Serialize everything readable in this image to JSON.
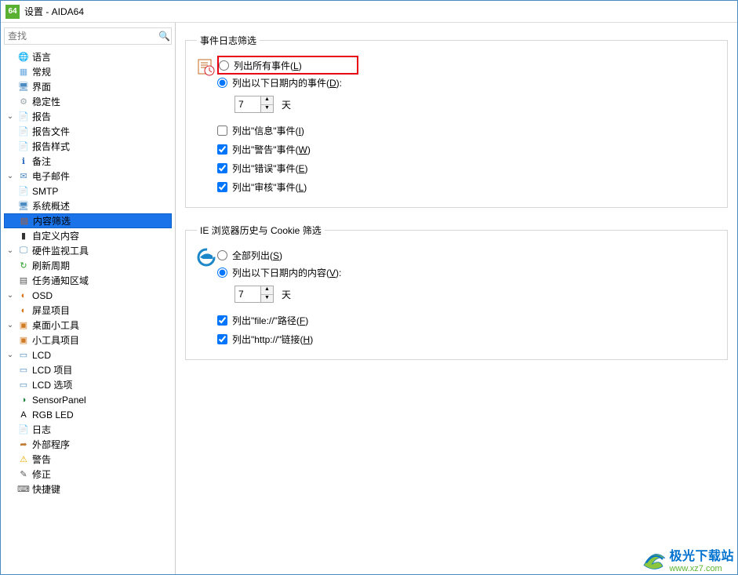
{
  "window": {
    "appicon": "64",
    "title": "设置 - AIDA64"
  },
  "search": {
    "placeholder": "查找"
  },
  "tree": [
    {
      "label": "语言",
      "depth": 0,
      "caret": "",
      "iconColor": "#1aa21a",
      "iconChar": "🌐"
    },
    {
      "label": "常规",
      "depth": 0,
      "caret": "",
      "iconColor": "#6aa9df",
      "iconChar": "▦"
    },
    {
      "label": "界面",
      "depth": 0,
      "caret": "",
      "iconColor": "#4d8cc2",
      "iconChar": "🖥"
    },
    {
      "label": "稳定性",
      "depth": 0,
      "caret": "",
      "iconColor": "#9aa6ad",
      "iconChar": "⚙"
    },
    {
      "label": "报告",
      "depth": 0,
      "caret": "v",
      "iconColor": "#e4aa35",
      "iconChar": "📄"
    },
    {
      "label": "报告文件",
      "depth": 1,
      "caret": "",
      "iconColor": "#999",
      "iconChar": "📄"
    },
    {
      "label": "报告样式",
      "depth": 1,
      "caret": "",
      "iconColor": "#999",
      "iconChar": "📄"
    },
    {
      "label": "备注",
      "depth": 1,
      "caret": "",
      "iconColor": "#2d6bc1",
      "iconChar": "ℹ"
    },
    {
      "label": "电子邮件",
      "depth": 0,
      "caret": "v",
      "iconColor": "#4d8cc2",
      "iconChar": "✉"
    },
    {
      "label": "SMTP",
      "depth": 1,
      "caret": "",
      "iconColor": "#999",
      "iconChar": "📄"
    },
    {
      "label": "系统概述",
      "depth": 0,
      "caret": "",
      "iconColor": "#4d8cc2",
      "iconChar": "🖥"
    },
    {
      "label": "内容筛选",
      "depth": 0,
      "caret": "",
      "iconColor": "#b06030",
      "iconChar": "▤",
      "selected": true
    },
    {
      "label": "自定义内容",
      "depth": 0,
      "caret": "",
      "iconColor": "#333",
      "iconChar": "▮"
    },
    {
      "label": "硬件监视工具",
      "depth": 0,
      "caret": "v",
      "iconColor": "#4d8cc2",
      "iconChar": "🖵"
    },
    {
      "label": "刷新周期",
      "depth": 1,
      "caret": "",
      "iconColor": "#2a9e2a",
      "iconChar": "↻"
    },
    {
      "label": "任务通知区域",
      "depth": 1,
      "caret": "",
      "iconColor": "#555",
      "iconChar": "▤"
    },
    {
      "label": "OSD",
      "depth": 1,
      "caret": "v",
      "iconColor": "#d86f12",
      "iconChar": "◐"
    },
    {
      "label": "屏显项目",
      "depth": 2,
      "caret": "",
      "iconColor": "#d86f12",
      "iconChar": "◐"
    },
    {
      "label": "桌面小工具",
      "depth": 1,
      "caret": "v",
      "iconColor": "#d07b25",
      "iconChar": "▣"
    },
    {
      "label": "小工具项目",
      "depth": 2,
      "caret": "",
      "iconColor": "#d07b25",
      "iconChar": "▣"
    },
    {
      "label": "LCD",
      "depth": 1,
      "caret": "v",
      "iconColor": "#4d8cc2",
      "iconChar": "▭"
    },
    {
      "label": "LCD 项目",
      "depth": 2,
      "caret": "",
      "iconColor": "#4d8cc2",
      "iconChar": "▭"
    },
    {
      "label": "LCD 选项",
      "depth": 2,
      "caret": "",
      "iconColor": "#4d8cc2",
      "iconChar": "▭"
    },
    {
      "label": "SensorPanel",
      "depth": 1,
      "caret": "",
      "iconColor": "#20833d",
      "iconChar": "◑"
    },
    {
      "label": "RGB LED",
      "depth": 1,
      "caret": "",
      "iconColor": "#000",
      "iconChar": "A"
    },
    {
      "label": "日志",
      "depth": 1,
      "caret": "",
      "iconColor": "#999",
      "iconChar": "📄"
    },
    {
      "label": "外部程序",
      "depth": 1,
      "caret": "",
      "iconColor": "#c07b30",
      "iconChar": "➦"
    },
    {
      "label": "警告",
      "depth": 1,
      "caret": "",
      "iconColor": "#e8a800",
      "iconChar": "⚠"
    },
    {
      "label": "修正",
      "depth": 1,
      "caret": "",
      "iconColor": "#555",
      "iconChar": "✎"
    },
    {
      "label": "快捷键",
      "depth": 1,
      "caret": "",
      "iconColor": "#555",
      "iconChar": "⌨"
    }
  ],
  "events": {
    "legend": "事件日志筛选",
    "radioAll": {
      "pre": "列出所有事件(",
      "u": "L",
      "post": ")"
    },
    "radioRange": {
      "pre": "列出以下日期内的事件(",
      "u": "D",
      "post": "):"
    },
    "days": "7",
    "unit": "天",
    "chk1": {
      "pre": "列出\"信息\"事件(",
      "u": "I",
      "post": ")",
      "checked": false
    },
    "chk2": {
      "pre": "列出\"警告\"事件(",
      "u": "W",
      "post": ")",
      "checked": true
    },
    "chk3": {
      "pre": "列出\"错误\"事件(",
      "u": "E",
      "post": ")",
      "checked": true
    },
    "chk4": {
      "pre": "列出\"审核\"事件(",
      "u": "L",
      "post": ")",
      "checked": true
    }
  },
  "ie": {
    "legend": "IE 浏览器历史与 Cookie 筛选",
    "radioAll": {
      "pre": "全部列出(",
      "u": "S",
      "post": ")"
    },
    "radioRange": {
      "pre": "列出以下日期内的内容(",
      "u": "V",
      "post": "):"
    },
    "days": "7",
    "unit": "天",
    "chk1": {
      "pre": "列出\"file://\"路径(",
      "u": "F",
      "post": ")",
      "checked": true
    },
    "chk2": {
      "pre": "列出\"http://\"链接(",
      "u": "H",
      "post": ")",
      "checked": true
    }
  },
  "watermark": {
    "title": "极光下载站",
    "url": "www.xz7.com"
  }
}
